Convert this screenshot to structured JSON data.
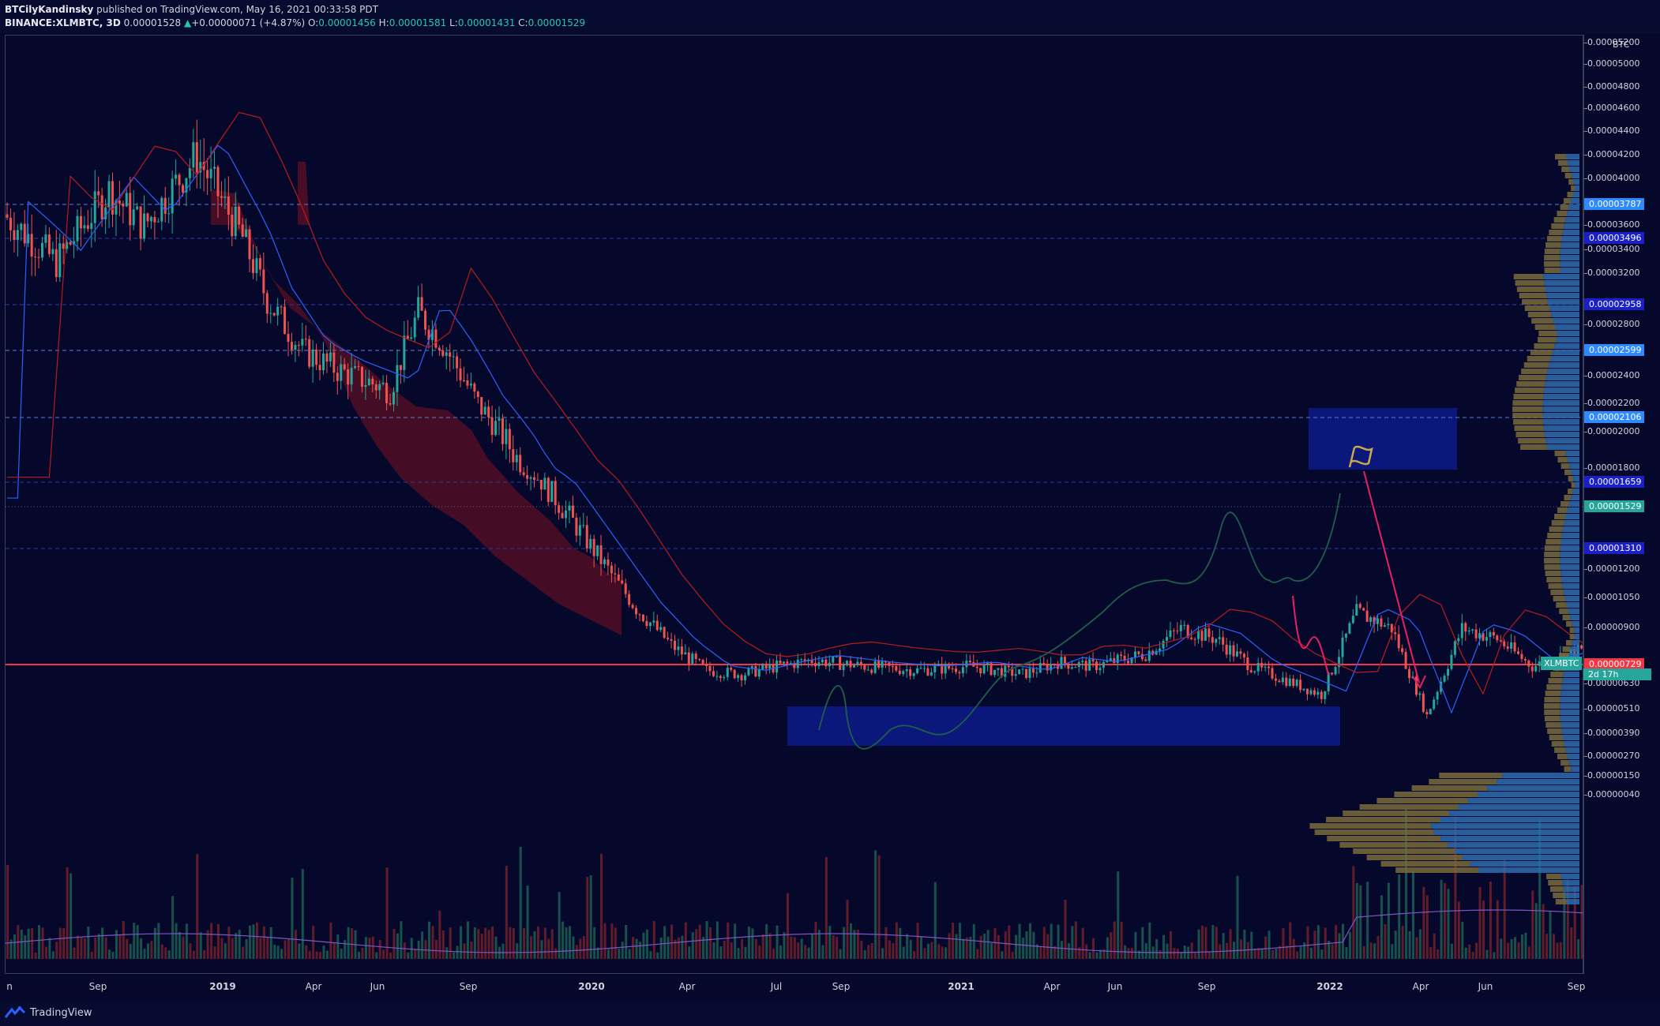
{
  "header": {
    "author": "BTCilyKandinsky",
    "published_text": "published on TradingView.com, May 16, 2021 00:33:58 PDT",
    "symbol": "BINANCE:XLMBTC, 3D",
    "last": "0.00001528",
    "change_arrow": "▲",
    "change": "+0.00000071 (+4.87%)",
    "open_label": "O:",
    "open": "0.00001456",
    "high_label": "H:",
    "high": "0.00001581",
    "low_label": "L:",
    "low": "0.00001431",
    "close_label": "C:",
    "close": "0.00001529"
  },
  "price_axis": {
    "unit": "BTC",
    "ticks": [
      {
        "label": "0.00005200",
        "value": 5.2
      },
      {
        "label": "0.00005000",
        "value": 5.0
      },
      {
        "label": "0.00004800",
        "value": 4.8
      },
      {
        "label": "0.00004600",
        "value": 4.6
      },
      {
        "label": "0.00004400",
        "value": 4.4
      },
      {
        "label": "0.00004200",
        "value": 4.2
      },
      {
        "label": "0.00004000",
        "value": 4.0
      },
      {
        "label": "0.00003600",
        "value": 3.6
      },
      {
        "label": "0.00003400",
        "value": 3.4
      },
      {
        "label": "0.00003200",
        "value": 3.2
      },
      {
        "label": "0.00002800",
        "value": 2.8
      },
      {
        "label": "0.00002400",
        "value": 2.4
      },
      {
        "label": "0.00002200",
        "value": 2.2
      },
      {
        "label": "0.00002000",
        "value": 2.0
      },
      {
        "label": "0.00001800",
        "value": 1.8
      },
      {
        "label": "0.00001200",
        "value": 1.2
      },
      {
        "label": "0.00001050",
        "value": 1.05
      },
      {
        "label": "0.00000900",
        "value": 0.9
      },
      {
        "label": "0.00000630",
        "value": 0.63
      },
      {
        "label": "0.00000510",
        "value": 0.51
      },
      {
        "label": "0.00000390",
        "value": 0.39
      },
      {
        "label": "0.00000270",
        "value": 0.27
      },
      {
        "label": "0.00000150",
        "value": 0.15
      },
      {
        "label": "0.00000040",
        "value": 0.04
      }
    ],
    "levels": [
      {
        "label": "0.00003787",
        "value": 3.787,
        "color": "#2962ff",
        "style": "light"
      },
      {
        "label": "0.00003496",
        "value": 3.496,
        "color": "#1a1fc8",
        "style": "dark"
      },
      {
        "label": "0.00002958",
        "value": 2.958,
        "color": "#1a1fc8",
        "style": "dark"
      },
      {
        "label": "0.00002599",
        "value": 2.599,
        "color": "#2962ff",
        "style": "light"
      },
      {
        "label": "0.00002106",
        "value": 2.106,
        "color": "#2962ff",
        "style": "light"
      },
      {
        "label": "0.00001659",
        "value": 1.659,
        "color": "#1a1fc8",
        "style": "dark"
      },
      {
        "label": "0.00001310",
        "value": 1.31,
        "color": "#1a1fc8",
        "style": "dark"
      },
      {
        "label": "0.00000729",
        "value": 0.729,
        "color": "#f23645",
        "style": "red"
      }
    ],
    "current": {
      "label": "0.00001529",
      "value": 1.529,
      "countdown": "2d 17h",
      "symbol": "XLMBTC"
    }
  },
  "time_axis": {
    "ticks": [
      {
        "label": "n",
        "bold": false
      },
      {
        "label": "Sep",
        "bold": false
      },
      {
        "label": "2019",
        "bold": true
      },
      {
        "label": "Apr",
        "bold": false
      },
      {
        "label": "Jun",
        "bold": false
      },
      {
        "label": "Sep",
        "bold": false
      },
      {
        "label": "2020",
        "bold": true
      },
      {
        "label": "Apr",
        "bold": false
      },
      {
        "label": "Jul",
        "bold": false
      },
      {
        "label": "Sep",
        "bold": false
      },
      {
        "label": "2021",
        "bold": true
      },
      {
        "label": "Apr",
        "bold": false
      },
      {
        "label": "Jun",
        "bold": false
      },
      {
        "label": "Sep",
        "bold": false
      },
      {
        "label": "2022",
        "bold": true
      },
      {
        "label": "Apr",
        "bold": false
      },
      {
        "label": "Jun",
        "bold": false
      },
      {
        "label": "Sep",
        "bold": false
      }
    ]
  },
  "footer": {
    "brand": "TradingView"
  },
  "colors": {
    "up": "#26a69a",
    "down": "#ef5350",
    "cloud": "#5a0f24",
    "zone": "#0d1a8a",
    "volume_profile_up": "#2d6cb0",
    "volume_profile_down": "#7a6a3a",
    "projection": "#1f5e4a",
    "arrow": "#e91e63"
  },
  "chart_data": {
    "type": "candlestick",
    "symbol": "XLMBTC",
    "exchange": "BINANCE",
    "interval": "3D",
    "price_scale_unit": "BTC",
    "ylim": [
      4e-07,
      5.2e-05
    ],
    "last_close": 1.529e-05,
    "grid": false
  }
}
